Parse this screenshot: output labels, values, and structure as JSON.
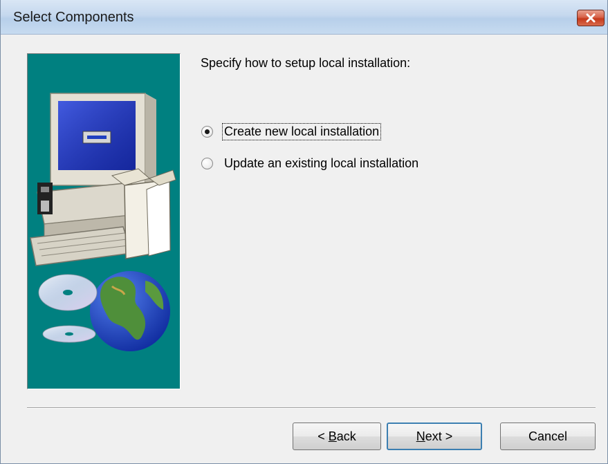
{
  "window": {
    "title": "Select Components",
    "close_icon": "close-x-icon"
  },
  "sidebar": {
    "image": "computer-install-illustration",
    "background_color": "#008080"
  },
  "content": {
    "prompt": "Specify how to setup local installation:",
    "options": [
      {
        "label": "Create new local installation",
        "selected": true
      },
      {
        "label": "Update an existing local installation",
        "selected": false
      }
    ]
  },
  "buttons": {
    "back": {
      "arrow": "<",
      "mnemonic": "B",
      "rest": "ack"
    },
    "next": {
      "mnemonic": "N",
      "rest": "ext",
      "arrow": ">"
    },
    "cancel": "Cancel"
  }
}
